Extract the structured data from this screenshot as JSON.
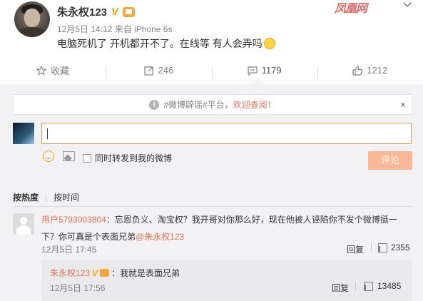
{
  "post": {
    "author_name": "朱永权123",
    "verified_badge": "V",
    "timestamp": "12月5日 14:12",
    "source": "来自 iPhone 6s",
    "text": "电脑死机了 开机都开不了。在线等 有人会弄吗"
  },
  "watermark": "凤凰网",
  "actions": {
    "favorite_label": "收藏",
    "repost_count": "246",
    "comment_count": "1179",
    "like_count": "1212"
  },
  "notice": {
    "prefix": "#微博辟谣#平台，",
    "link": "欢迎查阅！",
    "close": "×"
  },
  "composer": {
    "forward_label": "同时转发到我的微博",
    "submit_label": "评论"
  },
  "sort": {
    "active": "按热度",
    "other": "按时间"
  },
  "comment": {
    "user": "用户5793003804",
    "text": "：忘恩负义、淘宝权？我开哥对你那么好，现在他被人诬陷你不发个微博挺一下？你可真是个表面兄弟",
    "mention": "@朱永权123",
    "time": "12月5日 17:45",
    "reply_label": "回复",
    "likes": "2355"
  },
  "reply": {
    "user": "朱永权123",
    "verified_badge": "V",
    "text": "：我就是表面兄弟",
    "time": "12月5日 17:56",
    "reply_label": "回复",
    "likes": "13485"
  },
  "colors": {
    "accent": "#eb7350",
    "verified": "#f0a500",
    "submit_disabled": "#fbb896",
    "comment_bg": "#f2f2f5"
  },
  "icons": [
    "star-icon",
    "repost-icon",
    "comment-icon",
    "like-icon",
    "info-icon",
    "close-icon",
    "smile-icon",
    "image-icon",
    "chevron-down-icon"
  ]
}
